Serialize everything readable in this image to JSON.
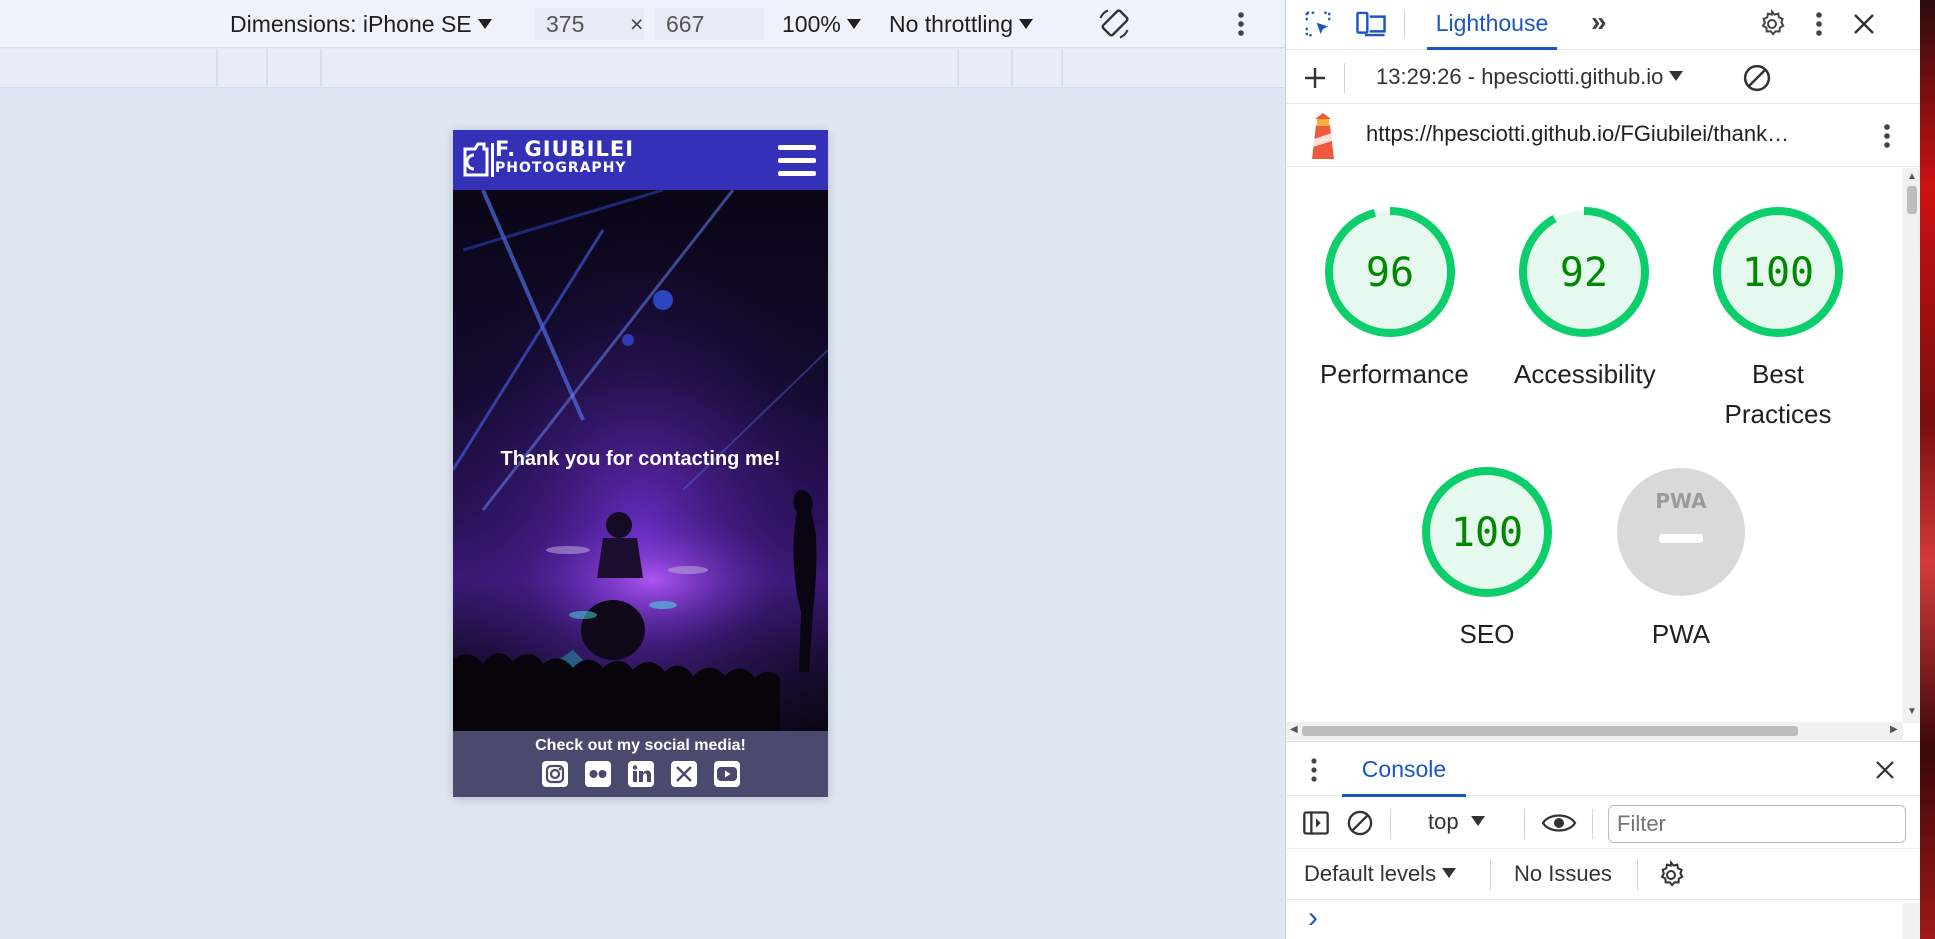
{
  "device_toolbar": {
    "dimensions_label": "Dimensions: iPhone SE",
    "width": "375",
    "times": "×",
    "height": "667",
    "zoom": "100%",
    "throttling": "No throttling",
    "rotate_icon": "rotate-icon",
    "more_icon": "kebab-icon"
  },
  "phone": {
    "logo_line1": "F. GIUBILEI",
    "logo_line2": "PHOTOGRAPHY",
    "hero_text": "Thank you for contacting me!",
    "footer_text": "Check out my social media!",
    "social_icons": [
      "instagram-icon",
      "flickr-icon",
      "linkedin-icon",
      "x-icon",
      "youtube-icon"
    ]
  },
  "devtools": {
    "tabs": {
      "active_tab": "Lighthouse",
      "more_tabs": "»"
    },
    "report": {
      "timestamp_label": "13:29:26 - hpesciotti.github.io"
    },
    "url": "https://hpesciotti.github.io/FGiubilei/thank…",
    "scores": [
      {
        "label": "Performance",
        "score": 96,
        "color": "#0cce6b",
        "text_color": "#008800"
      },
      {
        "label": "Accessibility",
        "score": 92,
        "color": "#0cce6b",
        "text_color": "#008800"
      },
      {
        "label": "Best Practices",
        "score": 100,
        "color": "#0cce6b",
        "text_color": "#008800"
      },
      {
        "label": "SEO",
        "score": 100,
        "color": "#0cce6b",
        "text_color": "#008800"
      },
      {
        "label": "PWA",
        "badge": "PWA",
        "color": "#cccccc"
      }
    ],
    "drawer": {
      "tab": "Console",
      "context": "top",
      "filter_placeholder": "Filter",
      "levels": "Default levels",
      "issues": "No Issues",
      "prompt": "›"
    }
  }
}
